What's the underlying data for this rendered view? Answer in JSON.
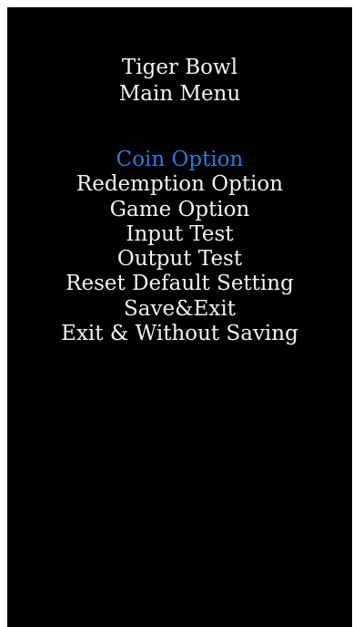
{
  "screen": {
    "title": "Tiger Bowl",
    "subtitle": "Main Menu"
  },
  "menu": {
    "selected_index": 0,
    "items": [
      {
        "label": "Coin Option"
      },
      {
        "label": "Redemption Option"
      },
      {
        "label": "Game Option"
      },
      {
        "label": "Input Test"
      },
      {
        "label": "Output Test"
      },
      {
        "label": "Reset Default Setting"
      },
      {
        "label": "Save&Exit"
      },
      {
        "label": "Exit & Without Saving"
      }
    ]
  },
  "colors": {
    "background": "#000000",
    "text": "#f2f2f2",
    "highlight": "#2f78d8"
  }
}
